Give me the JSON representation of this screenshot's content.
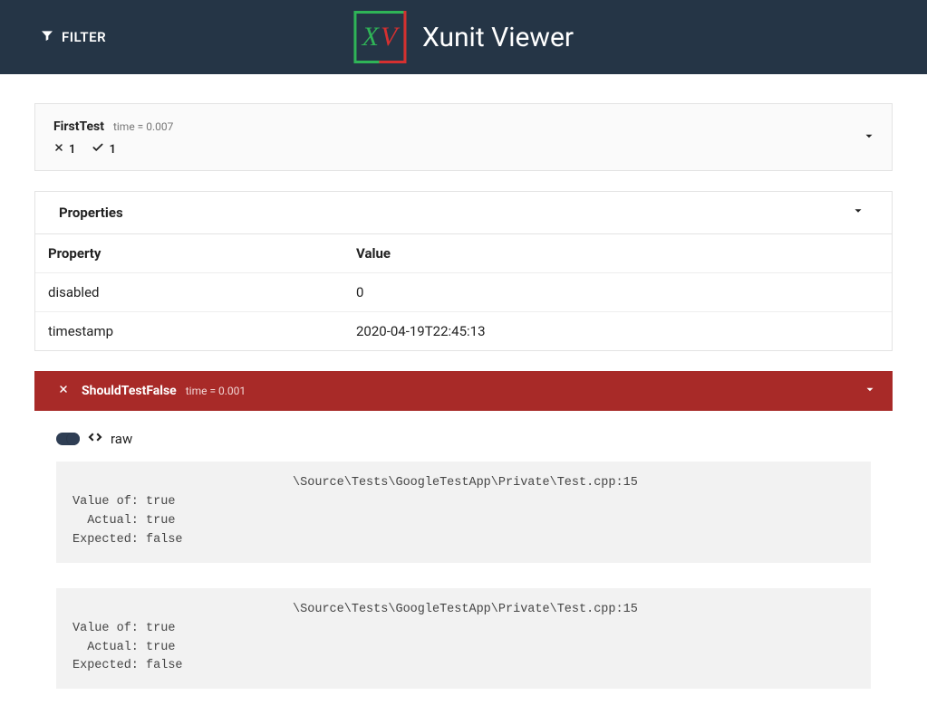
{
  "header": {
    "filter_label": "FILTER",
    "app_title": "Xunit Viewer",
    "logo_x": "X",
    "logo_v": "V"
  },
  "suite": {
    "name": "FirstTest",
    "time_label": "time = 0.007",
    "fail_count": "1",
    "pass_count": "1"
  },
  "properties": {
    "title": "Properties",
    "col_property": "Property",
    "col_value": "Value",
    "rows": [
      {
        "key": "disabled",
        "value": "0"
      },
      {
        "key": "timestamp",
        "value": "2020-04-19T22:45:13"
      }
    ]
  },
  "test": {
    "name": "ShouldTestFalse",
    "time_label": "time = 0.001",
    "raw_label": "raw",
    "blocks": [
      {
        "path_tail": "\\Source\\Tests\\GoogleTestApp\\Private\\Test.cpp:15",
        "lines": [
          "Value of: true",
          "  Actual: true",
          "Expected: false"
        ]
      },
      {
        "path_tail": "\\Source\\Tests\\GoogleTestApp\\Private\\Test.cpp:15",
        "lines": [
          "Value of: true",
          "  Actual: true",
          "Expected: false"
        ]
      }
    ]
  }
}
